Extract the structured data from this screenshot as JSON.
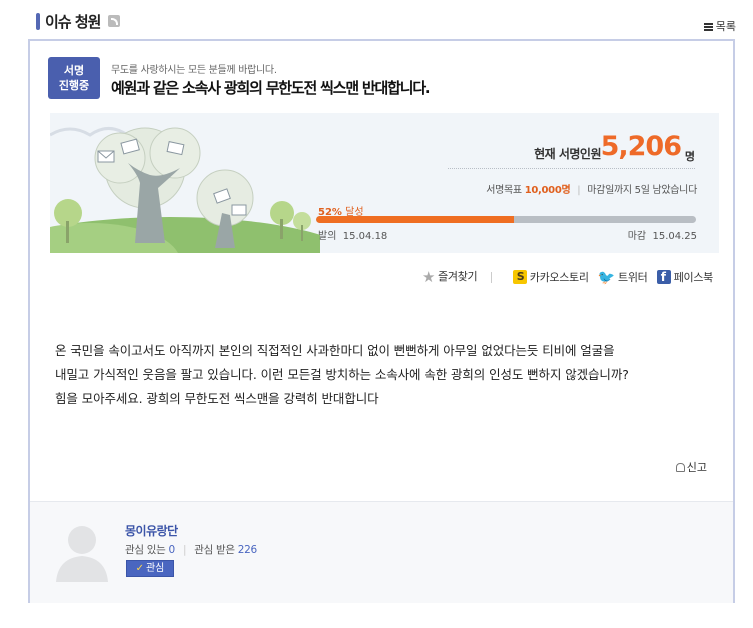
{
  "header": {
    "title": "이슈 청원",
    "rss_icon": "rss-icon",
    "list_label": "목록",
    "list_icon": "menu-lines-icon"
  },
  "petition": {
    "badge_line1": "서명",
    "badge_line2": "진행중",
    "subtitle": "무도를 사랑하시는 모든 분들께 바랍니다.",
    "title": "예원과 같은 소속사 광희의 무한도전 씩스맨 반대합니다."
  },
  "progress": {
    "signers_label": "현재 서명인원",
    "signers_count": "5,206",
    "signers_unit": "명",
    "goal_label": "서명목표",
    "goal_value": "10,000명",
    "deadline_text": "마감일까지 5일 남았습니다",
    "percent_value": "52%",
    "percent_suffix": "달성",
    "percent_fraction": 0.52,
    "start_label": "발의",
    "start_date": "15.04.18",
    "end_label": "마감",
    "end_date": "15.04.25",
    "accent_color": "#ef6e22"
  },
  "share": {
    "bookmark": "즐겨찾기",
    "kakao": "카카오스토리",
    "twitter": "트위터",
    "facebook": "페이스북"
  },
  "content": {
    "line1": "온 국민을 속이고서도  아직까지  본인의 직접적인 사과한마디 없이 뻔뻔하게 아무일 없었다는듯 티비에 얼굴을",
    "line2": "내밀고 가식적인 웃음을 팔고 있습니다. 이런 모든걸 방치하는 소속사에 속한 광희의 인성도 뻔하지 않겠습니까?",
    "line3": "힘을 모아주세요. 광희의 무한도전 씩스맨을 강력히 반대합니다"
  },
  "report_label": "신고",
  "author": {
    "name": "몽이유랑단",
    "interest_label": "관심 있는",
    "interest_count": "0",
    "received_label": "관심 받은",
    "received_count": "226",
    "follow_label": "관심"
  }
}
